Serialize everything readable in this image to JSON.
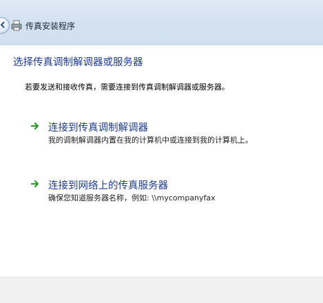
{
  "window": {
    "title": "传真安装程序"
  },
  "page": {
    "heading": "选择传真调制解调器或服务器",
    "intro": "若要发送和接收传真，需要连接到传真调制解调器或服务器。"
  },
  "options": [
    {
      "title": "连接到传真调制解调器",
      "description": "我的调制解调器内置在我的计算机中或连接到我的计算机上。",
      "icon": "green-arrow-icon"
    },
    {
      "title": "连接到网络上的传真服务器",
      "description": "确保您知道服务器名称，例如: \\\\mycompanyfax",
      "icon": "green-arrow-icon"
    }
  ],
  "colors": {
    "heading": "#1f3d8f",
    "arrow": "#2f9a2f",
    "titlebar": "#d3e1f1",
    "bottombar": "#f0f0f0"
  }
}
